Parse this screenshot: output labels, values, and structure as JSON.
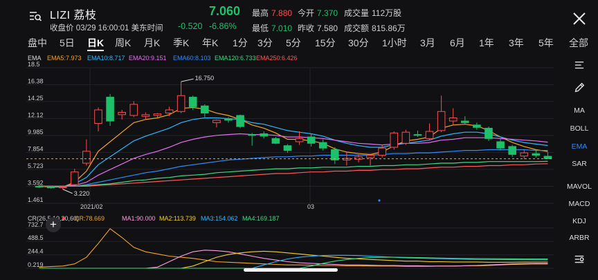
{
  "header": {
    "menu_icon": "search-list-icon",
    "ticker": "LIZI 荔枝",
    "close_time": "收盘价 03/29 16:00:01 美东时间",
    "price": "7.060",
    "change": "-0.520",
    "change_pct": "-6.86%",
    "stats": {
      "high_label": "最高",
      "high": "7.880",
      "open_label": "今开",
      "open": "7.370",
      "vol_label": "成交量",
      "vol": "112万股",
      "low_label": "最低",
      "low": "7.010",
      "prev_label": "昨收",
      "prev": "7.580",
      "amt_label": "成交额",
      "amt": "815.86万"
    },
    "close_icon": "close-icon"
  },
  "tabs": [
    "盘中",
    "5日",
    "日K",
    "周K",
    "月K",
    "季K",
    "年K",
    "1分",
    "3分",
    "5分",
    "15分",
    "30分",
    "1小时",
    "3月",
    "6月",
    "1年",
    "3年",
    "5年",
    "全部"
  ],
  "active_tab": "日K",
  "ema_legend": {
    "title": "EMA",
    "items": [
      {
        "label": "EMA5:7.973",
        "color": "#f5a623"
      },
      {
        "label": "EMA10:8.717",
        "color": "#2fb8ff"
      },
      {
        "label": "EMA20:9.151",
        "color": "#e56ef0"
      },
      {
        "label": "EMA60:8.103",
        "color": "#2f8cff"
      },
      {
        "label": "EMA120:6.733",
        "color": "#3ddc84"
      },
      {
        "label": "EMA250:6.426",
        "color": "#ff5b5b"
      }
    ]
  },
  "cr_legend": {
    "items": [
      {
        "label": "CR(26,5,10,20,60)",
        "color": "#cfcfcf"
      },
      {
        "label": "CR:78.669",
        "color": "#f5a623"
      },
      {
        "label": "MA1:90.000",
        "color": "#ff9ee0"
      },
      {
        "label": "MA2:113.739",
        "color": "#f7d02c"
      },
      {
        "label": "MA3:154.062",
        "color": "#2fb8ff"
      },
      {
        "label": "MA4:169.187",
        "color": "#3ddc84"
      }
    ]
  },
  "annotations": {
    "high": "16.750",
    "low": "3.220"
  },
  "x_labels": [
    "2021/02",
    "03"
  ],
  "side_tools": [
    "MA",
    "BOLL",
    "EMA",
    "SAR",
    "MAVOL",
    "MACD",
    "KDJ",
    "ARBR"
  ],
  "active_tool": "EMA",
  "chart_data": [
    {
      "type": "candlestick",
      "y_ticks": [
        18.5,
        16.38,
        14.25,
        12.12,
        9.985,
        7.854,
        5.723,
        3.592,
        1.461
      ],
      "ylim": [
        1.461,
        18.5
      ],
      "last_price_line": 7.06,
      "candles": [
        {
          "o": 3.6,
          "h": 3.8,
          "l": 3.4,
          "c": 3.5
        },
        {
          "o": 3.5,
          "h": 3.6,
          "l": 3.3,
          "c": 3.4
        },
        {
          "o": 3.4,
          "h": 3.6,
          "l": 3.22,
          "c": 3.5
        },
        {
          "o": 3.8,
          "h": 5.8,
          "l": 3.7,
          "c": 5.4
        },
        {
          "o": 6.5,
          "h": 9.5,
          "l": 6.2,
          "c": 8.0
        },
        {
          "o": 11.5,
          "h": 13.5,
          "l": 10.5,
          "c": 13.2
        },
        {
          "o": 14.8,
          "h": 15.2,
          "l": 11.2,
          "c": 11.8
        },
        {
          "o": 12.6,
          "h": 13.2,
          "l": 12.0,
          "c": 12.9
        },
        {
          "o": 12.5,
          "h": 14.3,
          "l": 12.3,
          "c": 13.9
        },
        {
          "o": 12.4,
          "h": 12.9,
          "l": 12.0,
          "c": 12.6
        },
        {
          "o": 12.5,
          "h": 12.8,
          "l": 12.1,
          "c": 12.7
        },
        {
          "o": 12.8,
          "h": 13.6,
          "l": 12.4,
          "c": 13.2
        },
        {
          "o": 13.0,
          "h": 16.75,
          "l": 12.8,
          "c": 15.0
        },
        {
          "o": 14.8,
          "h": 15.0,
          "l": 13.2,
          "c": 13.6
        },
        {
          "o": 13.7,
          "h": 13.9,
          "l": 12.3,
          "c": 12.8
        },
        {
          "o": 11.6,
          "h": 12.0,
          "l": 11.0,
          "c": 11.9
        },
        {
          "o": 12.1,
          "h": 12.3,
          "l": 11.6,
          "c": 11.9
        },
        {
          "o": 12.5,
          "h": 12.6,
          "l": 10.9,
          "c": 11.1
        },
        {
          "o": 10.1,
          "h": 10.3,
          "l": 8.7,
          "c": 10.0
        },
        {
          "o": 10.2,
          "h": 10.5,
          "l": 9.6,
          "c": 9.9
        },
        {
          "o": 9.6,
          "h": 9.8,
          "l": 8.9,
          "c": 9.0
        },
        {
          "o": 8.7,
          "h": 8.9,
          "l": 7.8,
          "c": 8.1
        },
        {
          "o": 9.2,
          "h": 10.5,
          "l": 8.8,
          "c": 9.6
        },
        {
          "o": 9.8,
          "h": 10.2,
          "l": 8.6,
          "c": 9.0
        },
        {
          "o": 9.1,
          "h": 9.5,
          "l": 8.1,
          "c": 8.4
        },
        {
          "o": 8.2,
          "h": 8.5,
          "l": 6.4,
          "c": 6.9
        },
        {
          "o": 6.9,
          "h": 7.9,
          "l": 6.2,
          "c": 7.1
        },
        {
          "o": 7.0,
          "h": 7.6,
          "l": 6.6,
          "c": 7.3
        },
        {
          "o": 7.2,
          "h": 7.6,
          "l": 6.2,
          "c": 7.5
        },
        {
          "o": 7.5,
          "h": 8.8,
          "l": 7.2,
          "c": 8.4
        },
        {
          "o": 8.5,
          "h": 10.5,
          "l": 8.2,
          "c": 10.3
        },
        {
          "o": 9.0,
          "h": 10.7,
          "l": 8.8,
          "c": 10.4
        },
        {
          "o": 10.1,
          "h": 10.6,
          "l": 9.8,
          "c": 10.0
        },
        {
          "o": 9.6,
          "h": 11.5,
          "l": 9.4,
          "c": 10.5
        },
        {
          "o": 10.6,
          "h": 15.0,
          "l": 10.4,
          "c": 13.0
        },
        {
          "o": 11.8,
          "h": 13.4,
          "l": 11.3,
          "c": 12.2
        },
        {
          "o": 11.8,
          "h": 12.4,
          "l": 11.4,
          "c": 11.6
        },
        {
          "o": 11.3,
          "h": 11.6,
          "l": 10.7,
          "c": 11.0
        },
        {
          "o": 10.9,
          "h": 11.1,
          "l": 9.3,
          "c": 9.6
        },
        {
          "o": 9.2,
          "h": 9.6,
          "l": 8.1,
          "c": 8.4
        },
        {
          "o": 8.6,
          "h": 8.8,
          "l": 7.3,
          "c": 7.6
        },
        {
          "o": 7.4,
          "h": 8.2,
          "l": 7.0,
          "c": 7.8
        },
        {
          "o": 7.7,
          "h": 8.2,
          "l": 7.2,
          "c": 7.5
        },
        {
          "o": 7.37,
          "h": 7.88,
          "l": 7.01,
          "c": 7.06
        }
      ],
      "ema_series": [
        {
          "values": [
            3.6,
            3.5,
            3.5,
            4.1,
            5.5,
            8.0,
            9.2,
            10.4,
            11.6,
            12.0,
            12.2,
            12.6,
            13.4,
            13.5,
            13.3,
            12.8,
            12.5,
            12.0,
            11.3,
            10.9,
            10.3,
            9.5,
            9.5,
            9.3,
            9.0,
            8.3,
            7.9,
            7.7,
            7.6,
            7.9,
            8.7,
            9.3,
            9.5,
            9.8,
            10.9,
            11.3,
            11.4,
            11.2,
            10.6,
            9.8,
            9.1,
            8.6,
            8.2,
            7.97
          ]
        },
        {
          "values": [
            3.6,
            3.6,
            3.5,
            3.9,
            4.7,
            6.3,
            7.3,
            8.3,
            9.3,
            9.9,
            10.4,
            10.9,
            11.6,
            12.0,
            12.2,
            12.2,
            12.1,
            12.0,
            11.6,
            11.4,
            11.0,
            10.6,
            10.4,
            10.2,
            9.9,
            9.4,
            9.0,
            8.7,
            8.5,
            8.5,
            8.8,
            9.0,
            9.2,
            9.4,
            9.9,
            10.2,
            10.4,
            10.4,
            10.2,
            9.8,
            9.4,
            9.1,
            8.9,
            8.72
          ]
        },
        {
          "values": [
            3.6,
            3.6,
            3.6,
            3.7,
            4.1,
            5.0,
            5.7,
            6.4,
            7.1,
            7.6,
            8.0,
            8.5,
            9.1,
            9.5,
            9.8,
            10.0,
            10.1,
            10.2,
            10.1,
            10.1,
            10.0,
            9.8,
            9.8,
            9.7,
            9.6,
            9.4,
            9.2,
            9.0,
            8.9,
            8.8,
            8.9,
            9.0,
            9.0,
            9.1,
            9.4,
            9.5,
            9.7,
            9.7,
            9.7,
            9.6,
            9.5,
            9.4,
            9.3,
            9.15
          ]
        },
        {
          "values": [
            3.6,
            3.6,
            3.6,
            3.6,
            3.8,
            4.1,
            4.4,
            4.7,
            5.0,
            5.3,
            5.5,
            5.8,
            6.1,
            6.3,
            6.5,
            6.7,
            6.9,
            7.0,
            7.1,
            7.2,
            7.3,
            7.3,
            7.4,
            7.4,
            7.5,
            7.5,
            7.5,
            7.5,
            7.5,
            7.6,
            7.7,
            7.7,
            7.8,
            7.8,
            7.9,
            8.0,
            8.1,
            8.1,
            8.2,
            8.2,
            8.2,
            8.2,
            8.1,
            8.1
          ]
        },
        {
          "values": [
            3.6,
            3.6,
            3.6,
            3.6,
            3.7,
            3.8,
            3.9,
            4.1,
            4.3,
            4.4,
            4.6,
            4.7,
            4.9,
            5.0,
            5.1,
            5.3,
            5.4,
            5.5,
            5.6,
            5.7,
            5.8,
            5.8,
            5.9,
            5.9,
            6.0,
            6.0,
            6.0,
            6.1,
            6.1,
            6.2,
            6.2,
            6.3,
            6.3,
            6.4,
            6.5,
            6.5,
            6.6,
            6.6,
            6.7,
            6.7,
            6.7,
            6.7,
            6.7,
            6.73
          ]
        },
        {
          "values": [
            3.6,
            3.6,
            3.6,
            3.6,
            3.6,
            3.7,
            3.8,
            3.9,
            4.0,
            4.1,
            4.2,
            4.3,
            4.4,
            4.5,
            4.6,
            4.7,
            4.8,
            4.9,
            5.0,
            5.1,
            5.2,
            5.2,
            5.3,
            5.4,
            5.4,
            5.5,
            5.5,
            5.6,
            5.6,
            5.7,
            5.7,
            5.8,
            5.8,
            5.9,
            6.0,
            6.0,
            6.1,
            6.1,
            6.2,
            6.2,
            6.3,
            6.3,
            6.4,
            6.43
          ]
        }
      ]
    },
    {
      "type": "line",
      "y_ticks": [
        732.7,
        488.5,
        244.4,
        0.219
      ],
      "ylim": [
        0.219,
        780
      ],
      "series": [
        {
          "values": [
            20,
            30,
            40,
            80,
            200,
            450,
            720,
            560,
            380,
            300,
            260,
            220,
            200,
            180,
            150,
            120,
            110,
            100,
            90,
            80,
            70,
            60,
            60,
            55,
            50,
            50,
            45,
            45,
            40,
            40,
            40,
            35,
            35,
            35,
            40,
            40,
            45,
            45,
            50,
            60,
            70,
            75,
            80,
            78.7
          ]
        },
        {
          "values": [
            0,
            0,
            0,
            0,
            0,
            0,
            0,
            0,
            0,
            0,
            20,
            120,
            220,
            300,
            330,
            320,
            300,
            260,
            220,
            180,
            150,
            120,
            100,
            90,
            80,
            70,
            60,
            60,
            55,
            50,
            50,
            45,
            45,
            40,
            40,
            40,
            45,
            50,
            60,
            70,
            80,
            85,
            90,
            90
          ]
        },
        {
          "values": [
            0,
            0,
            0,
            0,
            0,
            0,
            0,
            0,
            0,
            0,
            0,
            0,
            0,
            40,
            120,
            200,
            250,
            280,
            300,
            310,
            300,
            280,
            260,
            240,
            220,
            200,
            180,
            170,
            160,
            150,
            140,
            130,
            130,
            120,
            120,
            115,
            115,
            115,
            110,
            110,
            110,
            112,
            113,
            113.7
          ]
        },
        {
          "values": [
            0,
            0,
            0,
            0,
            0,
            0,
            0,
            0,
            0,
            0,
            0,
            0,
            0,
            0,
            0,
            0,
            0,
            0,
            0,
            60,
            120,
            170,
            200,
            220,
            230,
            235,
            235,
            230,
            220,
            210,
            200,
            190,
            185,
            180,
            175,
            170,
            165,
            160,
            160,
            158,
            156,
            155,
            154,
            154.1
          ]
        },
        {
          "values": [
            0,
            0,
            0,
            0,
            0,
            0,
            0,
            0,
            0,
            0,
            0,
            0,
            0,
            0,
            0,
            0,
            0,
            0,
            0,
            0,
            0,
            0,
            0,
            40,
            90,
            130,
            160,
            180,
            195,
            200,
            200,
            198,
            195,
            190,
            185,
            180,
            178,
            176,
            174,
            172,
            171,
            170,
            169,
            169.2
          ]
        }
      ]
    }
  ]
}
